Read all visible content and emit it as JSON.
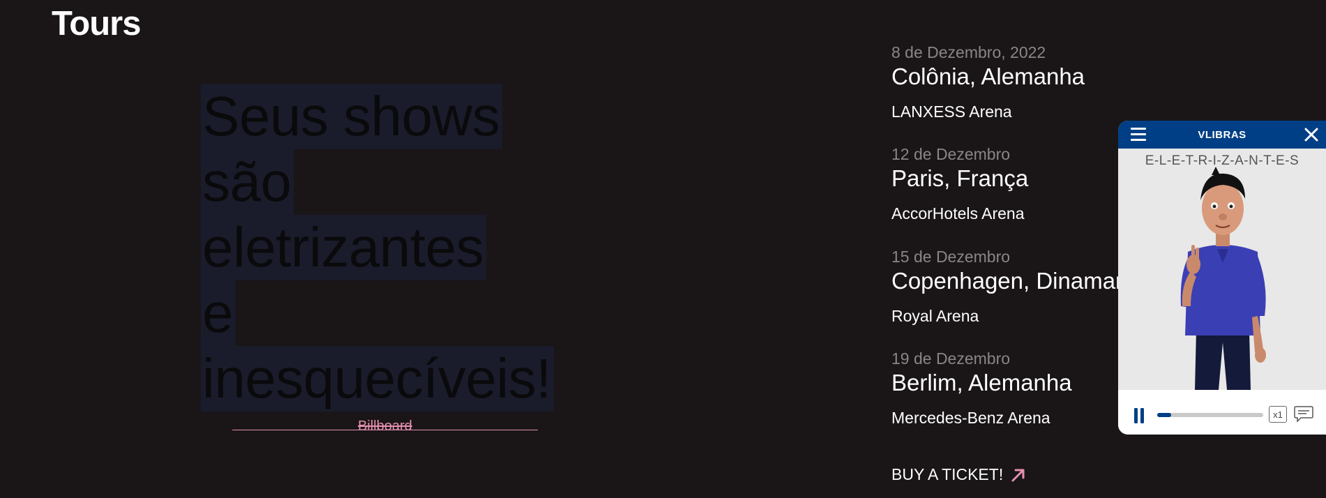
{
  "section": {
    "title": "Tours"
  },
  "quote": {
    "lines": [
      "Seus shows",
      "são",
      "eletrizantes",
      "e",
      "inesquecíveis!"
    ],
    "source": "Billboard"
  },
  "tours": [
    {
      "date": "8 de Dezembro, 2022",
      "city": "Colônia, Alemanha",
      "venue": "LANXESS Arena"
    },
    {
      "date": "12 de Dezembro",
      "city": "Paris, França",
      "venue": "AccorHotels Arena"
    },
    {
      "date": "15 de Dezembro",
      "city": "Copenhagen, Dinamarca",
      "venue": "Royal Arena"
    },
    {
      "date": "19 de Dezembro",
      "city": "Berlim, Alemanha",
      "venue": "Mercedes-Benz Arena"
    }
  ],
  "cta": {
    "label": "BUY A TICKET!",
    "icon": "arrow-up-right-icon"
  },
  "vlibras": {
    "title": "VLIBRAS",
    "gloss": "E-L-E-T-R-I-Z-A-N-T-E-S",
    "progress": 0.13,
    "speed": "x1"
  },
  "colors": {
    "background": "#1a1517",
    "quote_highlight": "#1a1c2b",
    "accent_pink": "#e58fb0",
    "vlibras_blue": "#003f86"
  }
}
